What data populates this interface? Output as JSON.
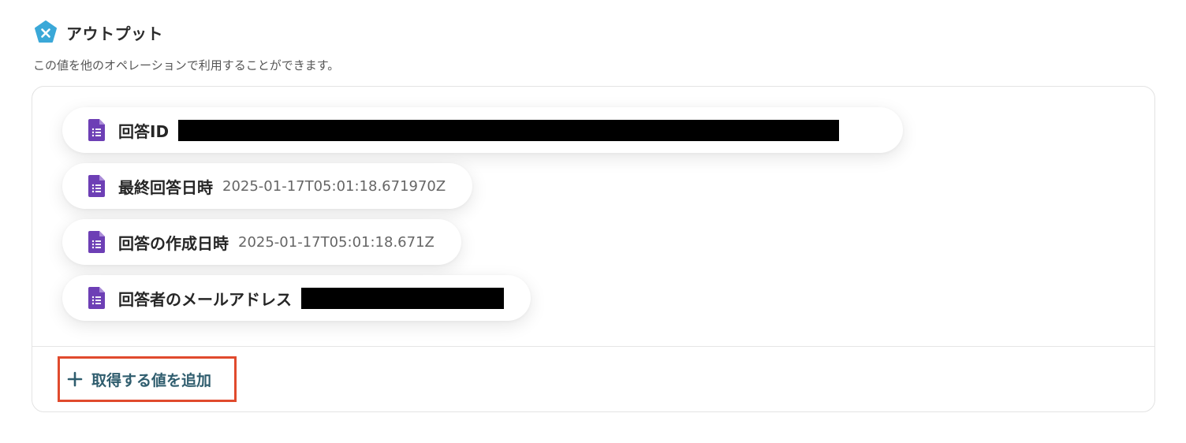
{
  "header": {
    "title": "アウトプット",
    "description": "この値を他のオペレーションで利用することができます。",
    "logo_icon": "x-pentagon-logo-icon",
    "accent_color": "#3aa8d8"
  },
  "outputs": [
    {
      "label": "回答ID",
      "value": "",
      "redacted": true,
      "icon": "google-forms-icon"
    },
    {
      "label": "最終回答日時",
      "value": "2025-01-17T05:01:18.671970Z",
      "redacted": false,
      "icon": "google-forms-icon"
    },
    {
      "label": "回答の作成日時",
      "value": "2025-01-17T05:01:18.671Z",
      "redacted": false,
      "icon": "google-forms-icon"
    },
    {
      "label": "回答者のメールアドレス",
      "value": "",
      "redacted": true,
      "icon": "google-forms-icon"
    }
  ],
  "add_button": {
    "label": "取得する値を追加",
    "icon": "plus-icon",
    "text_color": "#2f5d6e",
    "highlight_color": "#e04a2d"
  },
  "colors": {
    "forms_purple": "#6d3fb5"
  }
}
